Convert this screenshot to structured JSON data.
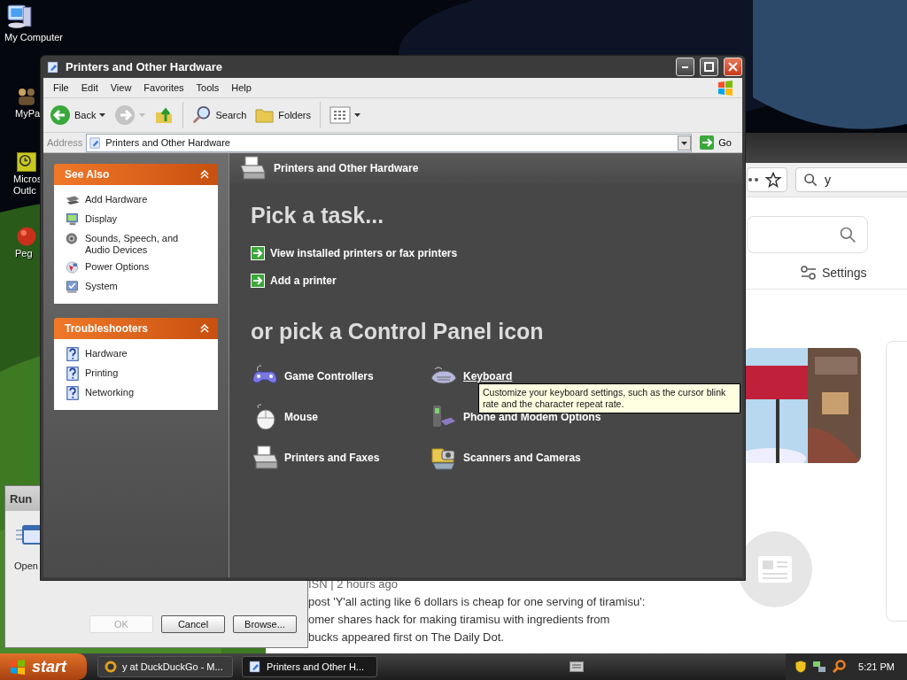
{
  "desktop_icons": [
    {
      "lines": [
        "My Computer"
      ]
    },
    {
      "lines": [
        "MyPa"
      ]
    },
    {
      "lines": [
        "Micros",
        "Outlc"
      ]
    },
    {
      "lines": [
        "Peg"
      ]
    }
  ],
  "browser": {
    "search_value": "y",
    "settings": "Settings",
    "news": {
      "source": "ISN | 2 hours ago",
      "lines": [
        "post 'Y'all acting like 6 dollars is cheap for one serving of tiramisu':",
        "omer shares hack for making tiramisu with ingredients from",
        "bucks appeared first on The Daily Dot."
      ]
    }
  },
  "run_dialog": {
    "title": "Run",
    "open_label": "Open",
    "buttons": [
      {
        "label": "OK",
        "disabled": true
      },
      {
        "label": "Cancel",
        "disabled": false
      },
      {
        "label": "Browse...",
        "disabled": false
      }
    ]
  },
  "window": {
    "title": "Printers and Other Hardware",
    "menu": [
      "File",
      "Edit",
      "View",
      "Favorites",
      "Tools",
      "Help"
    ],
    "toolbar": {
      "back": {
        "label": "Back",
        "disabled": false
      },
      "forward": {
        "disabled": true
      },
      "search": "Search",
      "folders": "Folders"
    },
    "address": {
      "label": "Address",
      "value": "Printers and Other Hardware",
      "go": "Go"
    },
    "sidebar": [
      {
        "title": "See Also",
        "expanded": true,
        "items": [
          "Add Hardware",
          "Display",
          "Sounds, Speech, and Audio Devices",
          "Power Options",
          "System"
        ]
      },
      {
        "title": "Troubleshooters",
        "expanded": true,
        "items": [
          "Hardware",
          "Printing",
          "Networking"
        ]
      }
    ],
    "header": "Printers and Other Hardware",
    "task_heading": "Pick a task...",
    "tasks": [
      "View installed printers or fax printers",
      "Add a printer"
    ],
    "icon_heading": "or pick a Control Panel icon",
    "icons": [
      {
        "label": "Game Controllers",
        "hovered": false
      },
      {
        "label": "Keyboard",
        "hovered": true
      },
      {
        "label": "Mouse",
        "hovered": false
      },
      {
        "label": "Phone and Modem Options",
        "hovered": false
      },
      {
        "label": "Printers and Faxes",
        "hovered": false
      },
      {
        "label": "Scanners and Cameras",
        "hovered": false
      }
    ],
    "tooltip": "Customize your keyboard settings, such as the cursor blink rate and the character repeat rate."
  },
  "taskbar": {
    "start": "start",
    "tasks": [
      {
        "label": "y at DuckDuckGo - M...",
        "selected": false
      },
      {
        "label": "Printers and Other H...",
        "selected": true
      }
    ],
    "clock": "5:21 PM"
  }
}
